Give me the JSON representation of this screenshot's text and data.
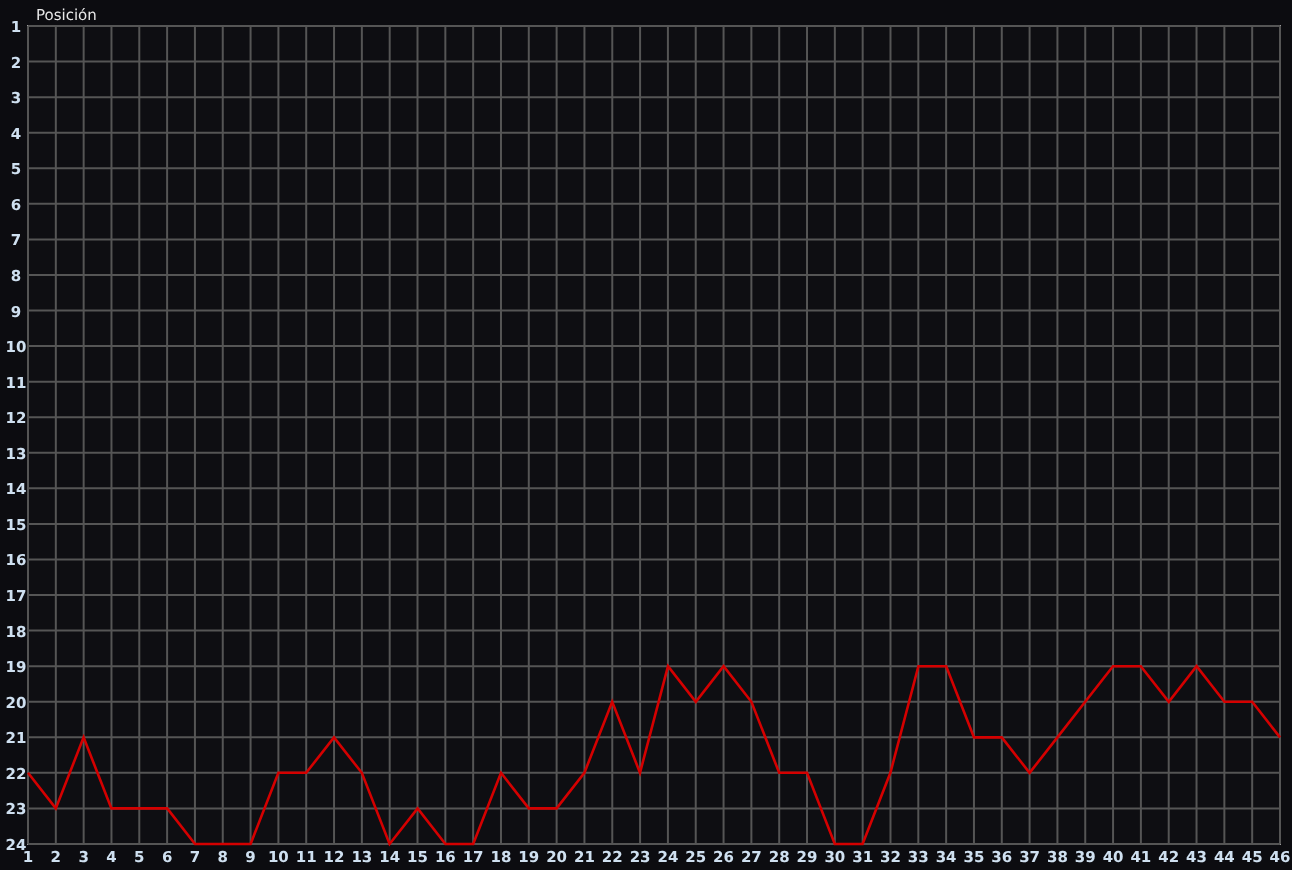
{
  "chart": {
    "chart_data": {
      "type": "line",
      "grid": true,
      "x": [
        1,
        2,
        3,
        4,
        5,
        6,
        7,
        8,
        9,
        10,
        11,
        12,
        13,
        14,
        15,
        16,
        17,
        18,
        19,
        20,
        21,
        22,
        23,
        24,
        25,
        26,
        27,
        28,
        29,
        30,
        31,
        32,
        33,
        34,
        35,
        36,
        37,
        38,
        39,
        40,
        41,
        42,
        43,
        44,
        45,
        46
      ],
      "series": [
        {
          "name": "Posición",
          "color": "#d40000",
          "values": [
            22,
            23,
            21,
            23,
            23,
            23,
            24,
            24,
            24,
            22,
            22,
            21,
            22,
            24,
            23,
            24,
            24,
            22,
            23,
            23,
            22,
            20,
            22,
            19,
            20,
            19,
            20,
            22,
            22,
            24,
            24,
            22,
            19,
            19,
            21,
            21,
            22,
            21,
            20,
            19,
            19,
            20,
            19,
            20,
            20,
            21
          ]
        }
      ],
      "xlim": [
        1,
        46
      ],
      "ylim": [
        24,
        1
      ],
      "xticks": [
        1,
        2,
        3,
        4,
        5,
        6,
        7,
        8,
        9,
        10,
        11,
        12,
        13,
        14,
        15,
        16,
        17,
        18,
        19,
        20,
        21,
        22,
        23,
        24,
        25,
        26,
        27,
        28,
        29,
        30,
        31,
        32,
        33,
        34,
        35,
        36,
        37,
        38,
        39,
        40,
        41,
        42,
        43,
        44,
        45,
        46
      ],
      "yticks": [
        1,
        2,
        3,
        4,
        5,
        6,
        7,
        8,
        9,
        10,
        11,
        12,
        13,
        14,
        15,
        16,
        17,
        18,
        19,
        20,
        21,
        22,
        23,
        24
      ]
    }
  }
}
